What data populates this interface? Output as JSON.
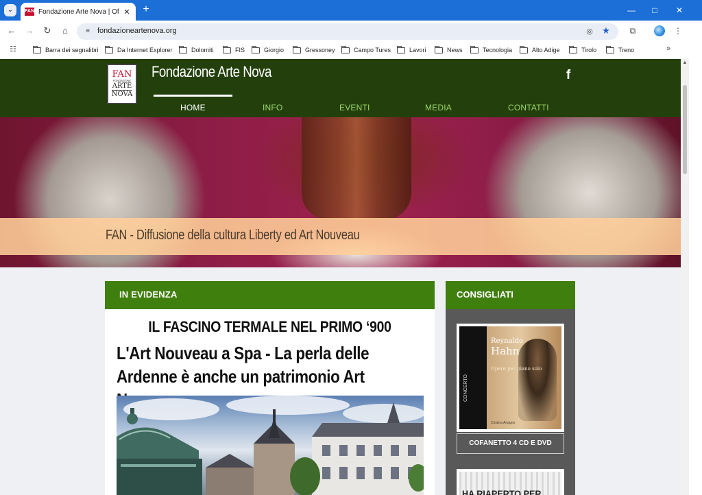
{
  "browser": {
    "tab_title": "Fondazione Arte Nova | Officia",
    "tab_favicon_text": "FAN",
    "url": "fondazioneartenova.org",
    "icons": {
      "tab_list": "chevron-down-icon",
      "close_tab": "close-icon",
      "new_tab": "plus-icon",
      "minimize": "minimize-icon",
      "maximize": "maximize-icon",
      "close_window": "close-window-icon",
      "back": "back-arrow-icon",
      "forward": "forward-arrow-icon",
      "reload": "reload-icon",
      "home": "home-icon",
      "site_info": "tune-icon",
      "eye_off": "eye-off-icon",
      "star": "star-icon",
      "extensions": "puzzle-icon",
      "menu": "kebab-menu-icon",
      "apps": "apps-grid-icon"
    },
    "accent_color": "#1b6fd6"
  },
  "bookmarks": [
    "Barra dei segnalibri",
    "Da Internet Explorer",
    "Dolomiti",
    "FIS",
    "Giorgio",
    "Gressoney",
    "Campo Tures",
    "Lavori",
    "News",
    "Tecnologia",
    "Alto Adige",
    "Tirolo",
    "Treno"
  ],
  "site": {
    "logo": {
      "top": "FAN",
      "mid": "ARTE",
      "bot": "NOVA",
      "tiny": "FONDAZIONE"
    },
    "title": "Fondazione Arte Nova",
    "social_icon": "facebook-icon",
    "nav": [
      "HOME",
      "INFO",
      "EVENTI",
      "MEDIA",
      "CONTATTI"
    ],
    "active_nav": "HOME",
    "header_color": "#23400c",
    "accent_green": "#3f7f0d",
    "hero_tagline": "FAN - Diffusione della cultura Liberty ed Art Nouveau"
  },
  "main": {
    "section_label": "IN EVIDENZA",
    "kicker": "IL FASCINO TERMALE NEL PRIMO ‘900",
    "headline": "L'Art Nouveau a Spa - La perla delle Ardenne è anche un patrimonio Art Nouveau"
  },
  "sidebar": {
    "section_label": "CONSIGLIATI",
    "cd": {
      "artist_first": "Reynaldo",
      "artist_last": "Hahn",
      "subtitle": "Opere per piano solo",
      "series": "CONCERTO",
      "performer": "Cristina Ariagno"
    },
    "cd_button": "COFANETTO 4 CD E DVD",
    "promo_text": "HA RIAPERTO PER"
  }
}
